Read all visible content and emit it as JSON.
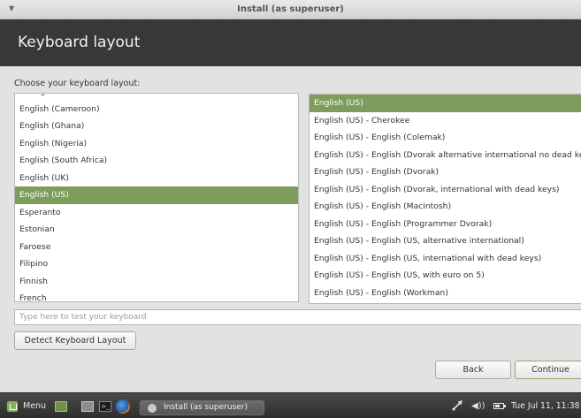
{
  "window": {
    "title": "Install (as superuser)"
  },
  "header": {
    "title": "Keyboard layout"
  },
  "prompt": "Choose your keyboard layout:",
  "layouts": [
    "Dzongkha",
    "English (Cameroon)",
    "English (Ghana)",
    "English (Nigeria)",
    "English (South Africa)",
    "English (UK)",
    "English (US)",
    "Esperanto",
    "Estonian",
    "Faroese",
    "Filipino",
    "Finnish",
    "French"
  ],
  "selected_layout": "English (US)",
  "variants": [
    "English (US)",
    "English (US) - Cherokee",
    "English (US) - English (Colemak)",
    "English (US) - English (Dvorak alternative international no dead keys)",
    "English (US) - English (Dvorak)",
    "English (US) - English (Dvorak, international with dead keys)",
    "English (US) - English (Macintosh)",
    "English (US) - English (Programmer Dvorak)",
    "English (US) - English (US, alternative international)",
    "English (US) - English (US, international with dead keys)",
    "English (US) - English (US, with euro on 5)",
    "English (US) - English (Workman)"
  ],
  "selected_variant": "English (US)",
  "test_field": {
    "placeholder": "Type here to test your keyboard",
    "value": ""
  },
  "buttons": {
    "detect": "Detect Keyboard Layout",
    "back": "Back",
    "continue": "Continue"
  },
  "taskbar": {
    "menu_label": "Menu",
    "task_label": "Install (as superuser)",
    "clock": "Tue Jul 11, 11:38",
    "icons": [
      "menu-icon",
      "show-desktop-icon",
      "file-manager-icon",
      "terminal-icon",
      "firefox-icon",
      "network-icon",
      "volume-icon",
      "battery-icon"
    ]
  },
  "colors": {
    "selection": "#7e9d5d",
    "header_bg": "#383838",
    "continue_border": "#8aa96a"
  }
}
